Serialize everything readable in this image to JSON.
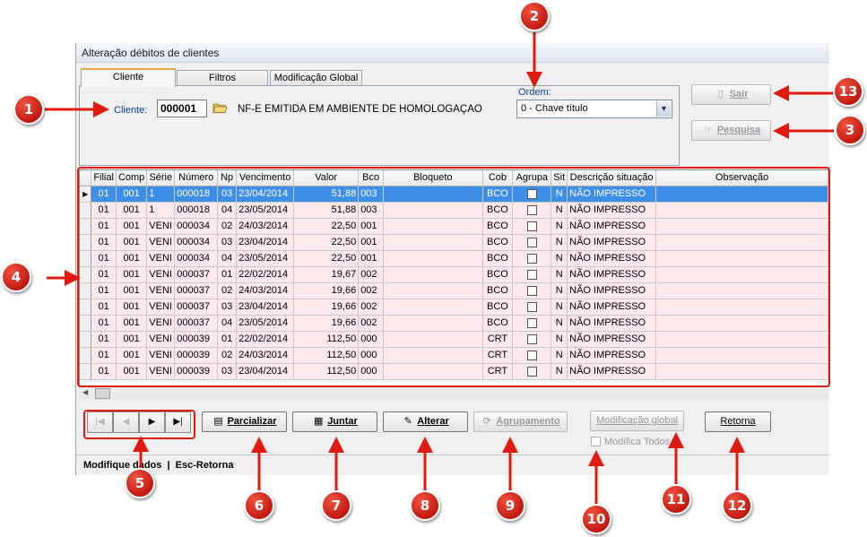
{
  "window": {
    "title": "Alteração débitos de clientes"
  },
  "tabs": [
    {
      "label": "Cliente",
      "active": true
    },
    {
      "label": "Filtros",
      "active": false
    },
    {
      "label": "Modificação Global",
      "active": false
    }
  ],
  "cliente": {
    "label": "Cliente:",
    "code": "000001",
    "name": "NF-E EMITIDA EM AMBIENTE DE HOMOLOGAÇAO"
  },
  "ordem": {
    "label": "Ordem:",
    "value": "0 - Chave título"
  },
  "buttons": {
    "sair": "Sair",
    "pesquisa": "Pesquisa",
    "parcializar": "Parcializar",
    "juntar": "Juntar",
    "alterar": "Alterar",
    "agrupamento": "Agrupamento",
    "modificacao_global": "Modificação global",
    "retorna": "Retorna"
  },
  "modifica_todos": "Modifica Todos",
  "grid": {
    "columns": [
      "Filial",
      "Comp",
      "Série",
      "Número",
      "Np",
      "Vencimento",
      "Valor",
      "Bco",
      "Bloqueto",
      "Cob",
      "Agrupa",
      "Sit",
      "Descrição situação",
      "Observação"
    ],
    "rows": [
      [
        "01",
        "001",
        "1",
        "000018",
        "03",
        "23/04/2014",
        "51,88",
        "003",
        "",
        "BCO",
        "",
        "N",
        "NÃO IMPRESSO",
        ""
      ],
      [
        "01",
        "001",
        "1",
        "000018",
        "04",
        "23/05/2014",
        "51,88",
        "003",
        "",
        "BCO",
        "",
        "N",
        "NÃO IMPRESSO",
        ""
      ],
      [
        "01",
        "001",
        "VENI",
        "000034",
        "02",
        "24/03/2014",
        "22,50",
        "001",
        "",
        "BCO",
        "",
        "N",
        "NÃO IMPRESSO",
        ""
      ],
      [
        "01",
        "001",
        "VENI",
        "000034",
        "03",
        "23/04/2014",
        "22,50",
        "001",
        "",
        "BCO",
        "",
        "N",
        "NÃO IMPRESSO",
        ""
      ],
      [
        "01",
        "001",
        "VENI",
        "000034",
        "04",
        "23/05/2014",
        "22,50",
        "001",
        "",
        "BCO",
        "",
        "N",
        "NÃO IMPRESSO",
        ""
      ],
      [
        "01",
        "001",
        "VENI",
        "000037",
        "01",
        "22/02/2014",
        "19,67",
        "002",
        "",
        "BCO",
        "",
        "N",
        "NÃO IMPRESSO",
        ""
      ],
      [
        "01",
        "001",
        "VENI",
        "000037",
        "02",
        "24/03/2014",
        "19,66",
        "002",
        "",
        "BCO",
        "",
        "N",
        "NÃO IMPRESSO",
        ""
      ],
      [
        "01",
        "001",
        "VENI",
        "000037",
        "03",
        "23/04/2014",
        "19,66",
        "002",
        "",
        "BCO",
        "",
        "N",
        "NÃO IMPRESSO",
        ""
      ],
      [
        "01",
        "001",
        "VENI",
        "000037",
        "04",
        "23/05/2014",
        "19,66",
        "002",
        "",
        "BCO",
        "",
        "N",
        "NÃO IMPRESSO",
        ""
      ],
      [
        "01",
        "001",
        "VENI",
        "000039",
        "01",
        "22/02/2014",
        "112,50",
        "000",
        "",
        "CRT",
        "",
        "N",
        "NÃO IMPRESSO",
        ""
      ],
      [
        "01",
        "001",
        "VENI",
        "000039",
        "02",
        "24/03/2014",
        "112,50",
        "000",
        "",
        "CRT",
        "",
        "N",
        "NÃO IMPRESSO",
        ""
      ],
      [
        "01",
        "001",
        "VENI",
        "000039",
        "03",
        "23/04/2014",
        "112,50",
        "000",
        "",
        "CRT",
        "",
        "N",
        "NÃO IMPRESSO",
        ""
      ]
    ],
    "selected_row": 0
  },
  "status": "Modifique dados  |  Esc-Retorna",
  "callouts": [
    "1",
    "2",
    "3",
    "4",
    "5",
    "6",
    "7",
    "8",
    "9",
    "10",
    "11",
    "12",
    "13"
  ],
  "colors": {
    "callout_red": "#e01a10",
    "selection": "#3d8ee6",
    "row_pink": "#fde8ec"
  }
}
